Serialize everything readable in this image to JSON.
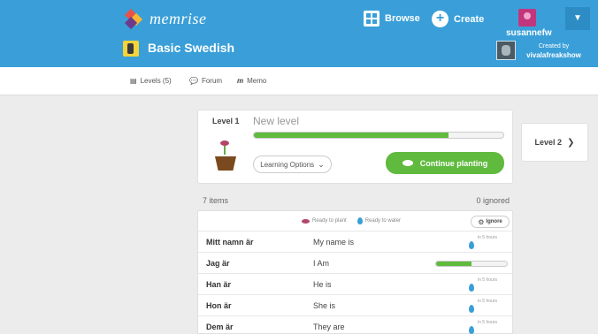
{
  "header": {
    "logo_text": "memrise",
    "browse_label": "Browse",
    "create_label": "Create",
    "username": "susannefw",
    "course_title": "Basic Swedish",
    "created_by_label": "Created by",
    "creator_name": "vivalafreakshow",
    "brand_color": "#3a9fd8"
  },
  "subnav": {
    "levels_label": "Levels (5)",
    "forum_label": "Forum",
    "memo_label": "Memo"
  },
  "level_card": {
    "level_number": "Level 1",
    "level_name": "New level",
    "progress": 0.78,
    "learning_options_label": "Learning Options",
    "continue_label": "Continue planting"
  },
  "next_level": {
    "label": "Level 2"
  },
  "items": {
    "count_label": "7 items",
    "ignored_label": "0 ignored",
    "legend_plant": "Ready to plant",
    "legend_water": "Ready to water",
    "ignore_label": "Ignore",
    "rows": [
      {
        "swedish": "Mitt namn är",
        "english": "My name is",
        "status": "water",
        "time": "in 5 hours"
      },
      {
        "swedish": "Jag är",
        "english": "I Am",
        "status": "progress",
        "progress": 0.5
      },
      {
        "swedish": "Han är",
        "english": "He is",
        "status": "water",
        "time": "in 5 hours"
      },
      {
        "swedish": "Hon är",
        "english": "She is",
        "status": "water",
        "time": "in 5 hours"
      },
      {
        "swedish": "Dem är",
        "english": "They are",
        "status": "water",
        "time": "in 5 hours"
      }
    ]
  }
}
